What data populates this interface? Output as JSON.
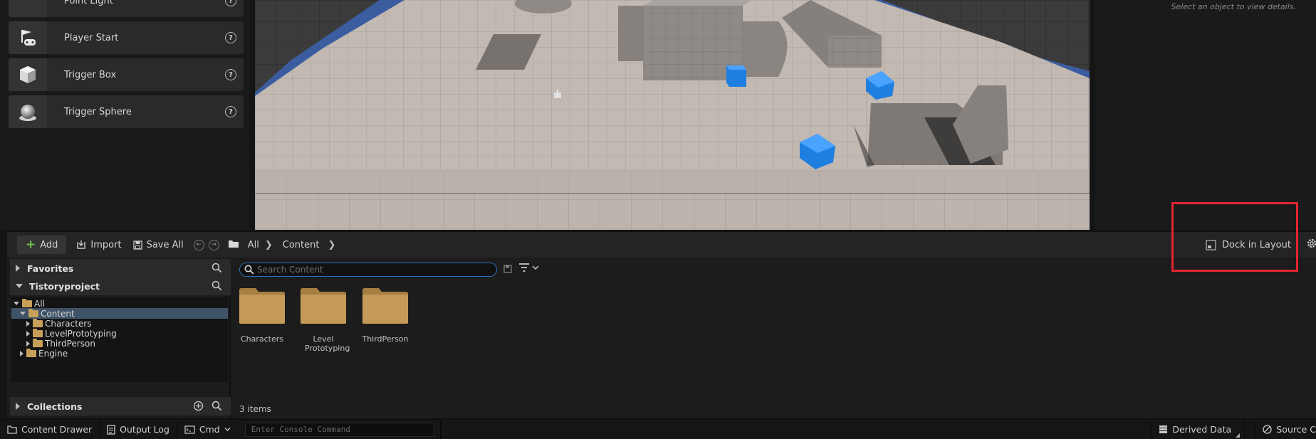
{
  "place_actors": {
    "items": [
      {
        "label": "Point Light",
        "icon": "bulb-icon"
      },
      {
        "label": "Player Start",
        "icon": "flag-gamepad-icon"
      },
      {
        "label": "Trigger Box",
        "icon": "cube-icon"
      },
      {
        "label": "Trigger Sphere",
        "icon": "sphere-icon"
      }
    ]
  },
  "details": {
    "hint": "Select an object to view details."
  },
  "content_browser": {
    "toolbar": {
      "add_label": "Add",
      "import_label": "Import",
      "save_all_label": "Save All",
      "breadcrumb": [
        "All",
        "Content"
      ],
      "dock_label": "Dock in Layout"
    },
    "sources": {
      "favorites_label": "Favorites",
      "project_label": "Tistoryproject",
      "collections_label": "Collections",
      "tree": [
        {
          "label": "All",
          "depth": 0,
          "expanded": true
        },
        {
          "label": "Content",
          "depth": 1,
          "expanded": true,
          "selected": true
        },
        {
          "label": "Characters",
          "depth": 2,
          "expanded": false
        },
        {
          "label": "LevelPrototyping",
          "depth": 2,
          "expanded": false
        },
        {
          "label": "ThirdPerson",
          "depth": 2,
          "expanded": false
        },
        {
          "label": "Engine",
          "depth": 1,
          "expanded": false
        }
      ]
    },
    "search": {
      "placeholder": "Search Content",
      "value": ""
    },
    "assets": [
      {
        "name": "Characters"
      },
      {
        "name": "Level Prototyping"
      },
      {
        "name": "ThirdPerson"
      }
    ],
    "item_count": "3 items"
  },
  "statusbar": {
    "content_drawer": "Content Drawer",
    "output_log": "Output Log",
    "cmd": "Cmd",
    "console_placeholder": "Enter Console Command",
    "derived_data": "Derived Data",
    "source_control": "Source C"
  },
  "colors": {
    "highlight": "#e3262f",
    "selected_row": "#3f5368",
    "folder": "#c8a05a",
    "sky": "#3b5da0",
    "cube": "#1f7fe0"
  }
}
